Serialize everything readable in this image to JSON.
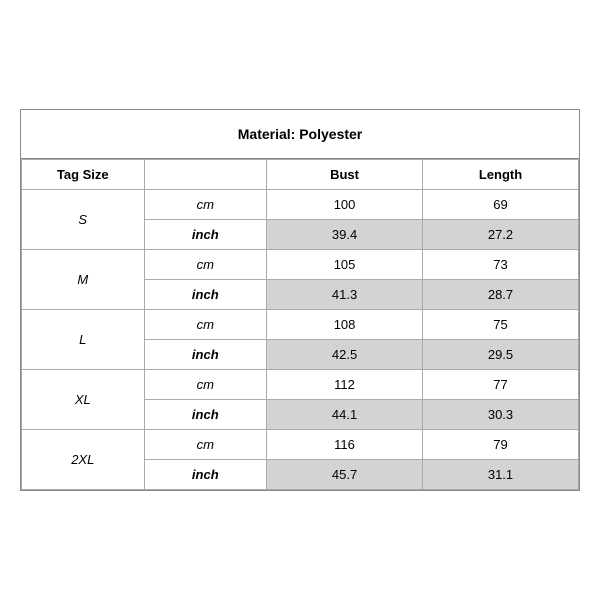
{
  "title": "Material: Polyester",
  "headers": {
    "tagSize": "Tag Size",
    "bust": "Bust",
    "length": "Length"
  },
  "rows": [
    {
      "size": "S",
      "cm": {
        "bust": "100",
        "length": "69"
      },
      "inch": {
        "bust": "39.4",
        "length": "27.2"
      }
    },
    {
      "size": "M",
      "cm": {
        "bust": "105",
        "length": "73"
      },
      "inch": {
        "bust": "41.3",
        "length": "28.7"
      }
    },
    {
      "size": "L",
      "cm": {
        "bust": "108",
        "length": "75"
      },
      "inch": {
        "bust": "42.5",
        "length": "29.5"
      }
    },
    {
      "size": "XL",
      "cm": {
        "bust": "112",
        "length": "77"
      },
      "inch": {
        "bust": "44.1",
        "length": "30.3"
      }
    },
    {
      "size": "2XL",
      "cm": {
        "bust": "116",
        "length": "79"
      },
      "inch": {
        "bust": "45.7",
        "length": "31.1"
      }
    }
  ],
  "units": {
    "cm": "cm",
    "inch": "inch"
  }
}
